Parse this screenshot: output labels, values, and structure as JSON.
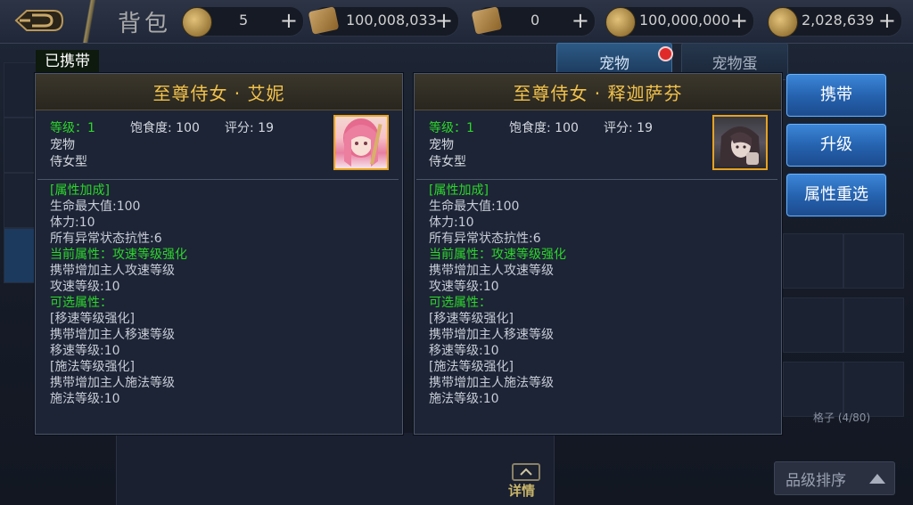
{
  "top_bar": {
    "title": "背包",
    "resources": [
      {
        "value": "5",
        "icon": "gold-coin-icon"
      },
      {
        "value": "100,008,033",
        "icon": "scroll-icon"
      },
      {
        "value": "0",
        "icon": "locked-scroll-icon"
      },
      {
        "value": "100,000,000",
        "icon": "coin-icon"
      },
      {
        "value": "2,028,639",
        "icon": "bound-coin-icon"
      }
    ],
    "plus_label": "+"
  },
  "tabs": [
    {
      "label": "宠物"
    },
    {
      "label": "宠物蛋"
    }
  ],
  "carried_label": "已携带",
  "panels": [
    {
      "name": "至尊侍女 · 艾妮",
      "level_label": "等级：",
      "level": "1",
      "satiety": "饱食度: 100",
      "score": "评分: 19",
      "category": "宠物",
      "type": "侍女型",
      "portrait_icon": "pink-hair-girl-portrait",
      "attrs": [
        {
          "text": "[属性加成]",
          "green": true
        },
        {
          "text": "生命最大值:100",
          "green": false
        },
        {
          "text": "体力:10",
          "green": false
        },
        {
          "text": "所有异常状态抗性:6",
          "green": false
        },
        {
          "text": "当前属性：攻速等级强化",
          "green": true
        },
        {
          "text": "携带增加主人攻速等级",
          "green": false
        },
        {
          "text": "攻速等级:10",
          "green": false
        },
        {
          "text": "可选属性：",
          "green": true
        },
        {
          "text": "[移速等级强化]",
          "green": false
        },
        {
          "text": "携带增加主人移速等级",
          "green": false
        },
        {
          "text": "移速等级:10",
          "green": false
        },
        {
          "text": "[施法等级强化]",
          "green": false
        },
        {
          "text": "携带增加主人施法等级",
          "green": false
        },
        {
          "text": "施法等级:10",
          "green": false
        }
      ]
    },
    {
      "name": "至尊侍女 · 释迦萨芬",
      "level_label": "等级：",
      "level": "1",
      "satiety": "饱食度: 100",
      "score": "评分: 19",
      "category": "宠物",
      "type": "侍女型",
      "portrait_icon": "dark-hair-girl-portrait",
      "attrs": [
        {
          "text": "[属性加成]",
          "green": true
        },
        {
          "text": "生命最大值:100",
          "green": false
        },
        {
          "text": "体力:10",
          "green": false
        },
        {
          "text": "所有异常状态抗性:6",
          "green": false
        },
        {
          "text": "当前属性：攻速等级强化",
          "green": true
        },
        {
          "text": "携带增加主人攻速等级",
          "green": false
        },
        {
          "text": "攻速等级:10",
          "green": false
        },
        {
          "text": "可选属性：",
          "green": true
        },
        {
          "text": "[移速等级强化]",
          "green": false
        },
        {
          "text": "携带增加主人移速等级",
          "green": false
        },
        {
          "text": "移速等级:10",
          "green": false
        },
        {
          "text": "[施法等级强化]",
          "green": false
        },
        {
          "text": "携带增加主人施法等级",
          "green": false
        },
        {
          "text": "施法等级:10",
          "green": false
        }
      ]
    }
  ],
  "actions": {
    "carry": "携带",
    "upgrade": "升级",
    "reroll": "属性重选"
  },
  "grid_count": "格子 (4/80)",
  "sort_label": "品级排序",
  "detail_label": "详情"
}
